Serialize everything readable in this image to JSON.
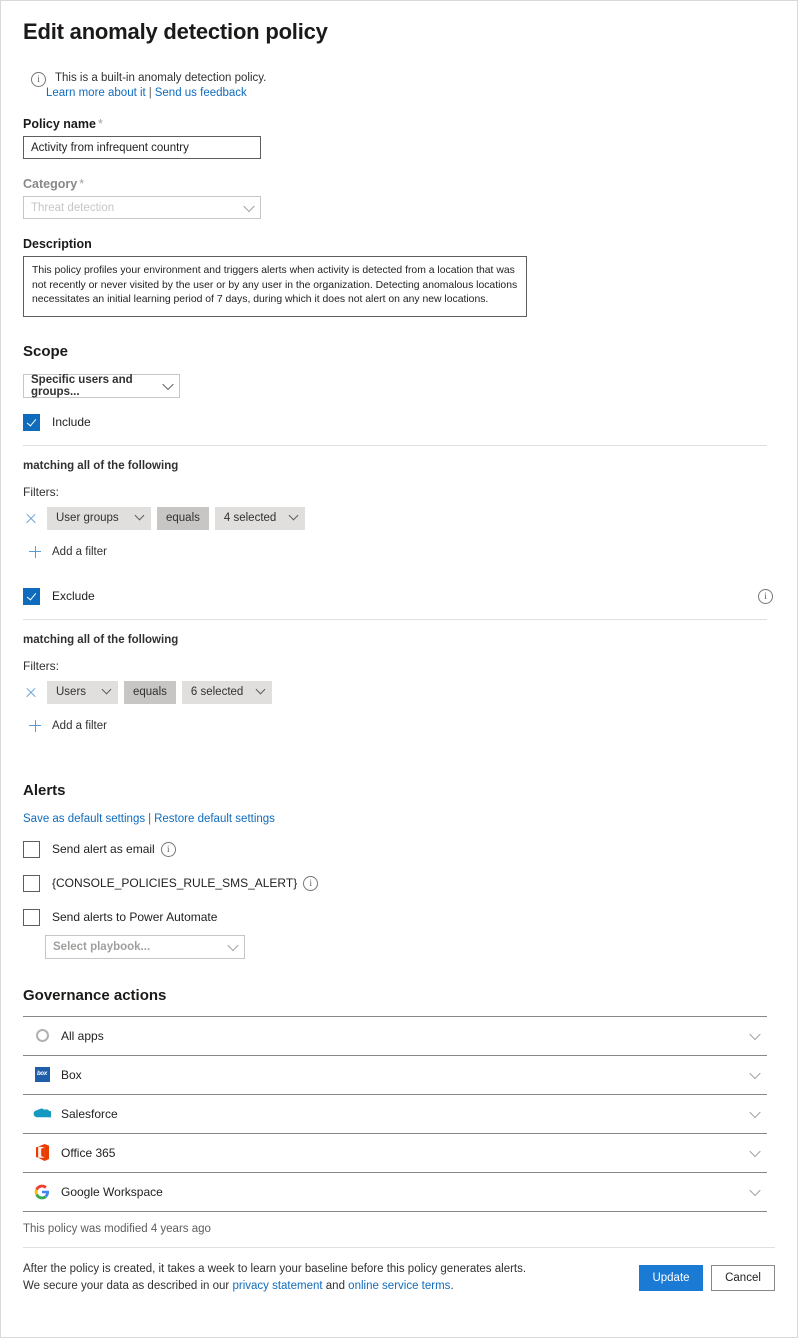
{
  "page": {
    "title": "Edit anomaly detection policy"
  },
  "banner": {
    "icon": "info-icon",
    "text": "This is a built-in anomaly detection policy.",
    "link_learn": "Learn more about it",
    "separator": "|",
    "link_feedback": "Send us feedback"
  },
  "policy_name": {
    "label": "Policy name",
    "required_mark": "*",
    "value": "Activity from infrequent country",
    "placeholder": "Policy name"
  },
  "category": {
    "label": "Category",
    "required_mark": "*",
    "value": "Threat detection",
    "chevron": "chevron-down-icon"
  },
  "description": {
    "label": "Description",
    "value": "This policy profiles your environment and triggers alerts when activity is detected from a location that was not recently or never visited by the user or by any user in the organization. Detecting anomalous locations necessitates an initial learning period of 7 days, during which it does not alert on any new locations."
  },
  "scope": {
    "heading": "Scope",
    "selector_value": "Specific users and groups...",
    "include": {
      "label": "Include",
      "checked": true,
      "matching_text": "matching all of the following",
      "filters_label": "Filters:",
      "filter": {
        "field": "User groups",
        "operator": "equals",
        "value": "4 selected"
      },
      "add_filter": "Add a filter"
    },
    "exclude": {
      "label": "Exclude",
      "checked": true,
      "info_icon": "info-icon",
      "matching_text": "matching all of the following",
      "filters_label": "Filters:",
      "filter": {
        "field": "Users",
        "operator": "equals",
        "value": "6 selected"
      },
      "add_filter": "Add a filter"
    }
  },
  "alerts": {
    "heading": "Alerts",
    "save_default": "Save as default settings",
    "separator": "|",
    "restore_default": "Restore default settings",
    "checkboxes": [
      {
        "label": "Send alert as email",
        "checked": false,
        "has_info": true
      },
      {
        "label": "{CONSOLE_POLICIES_RULE_SMS_ALERT}",
        "checked": false,
        "has_info": true
      },
      {
        "label": "Send alerts to Power Automate",
        "checked": false,
        "has_info": false
      }
    ],
    "playbook": {
      "placeholder": "Select playbook...",
      "chevron": "chevron-down-icon"
    }
  },
  "governance": {
    "heading": "Governance actions",
    "rows": [
      {
        "name": "All apps",
        "icon": "all-apps-icon"
      },
      {
        "name": "Box",
        "icon": "box-logo-icon"
      },
      {
        "name": "Salesforce",
        "icon": "salesforce-logo-icon"
      },
      {
        "name": "Office 365",
        "icon": "office365-logo-icon"
      },
      {
        "name": "Google Workspace",
        "icon": "google-workspace-logo-icon"
      }
    ]
  },
  "footer": {
    "modified": "This policy was modified 4 years ago",
    "line1": "After the policy is created, it takes a week to learn your baseline before this policy generates alerts.",
    "line2_prefix": "We secure your data as described in our ",
    "link_privacy": "privacy statement",
    "line2_mid": " and ",
    "link_terms": "online service terms",
    "line2_suffix": ".",
    "update_button": "Update",
    "cancel_button": "Cancel"
  },
  "colors": {
    "accent_blue": "#0f6cbd",
    "button_blue": "#1a7ad4",
    "link_blue": "#0f6cbd",
    "pill_gray": "#e1dfdd",
    "pill_dark_gray": "#c8c6c4"
  }
}
